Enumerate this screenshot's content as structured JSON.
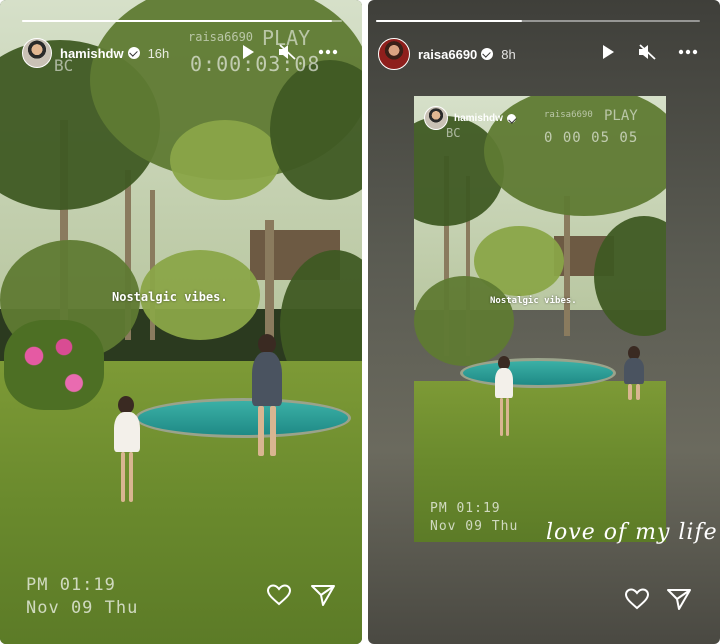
{
  "left_story": {
    "username": "hamishdw",
    "time_ago": "16h",
    "vhs_top_left": "raisa6690",
    "vhs_play": "PLAY",
    "vhs_bc": "BC",
    "vhs_timecode": "0:00:03:08",
    "caption": "Nostalgic vibes.",
    "date_line1": "PM 01:19",
    "date_line2": "Nov 09 Thu",
    "progress": 0.97,
    "icons": [
      "play-icon",
      "mute-icon",
      "more-icon",
      "heart-icon",
      "send-icon"
    ]
  },
  "right_story": {
    "username": "raisa6690",
    "time_ago": "8h",
    "progress": 0.5,
    "shared_post": {
      "username": "hamishdw",
      "vhs_top_left": "raisa6690",
      "vhs_play": "PLAY",
      "vhs_bc": "BC",
      "vhs_timecode": "0 00 05 05",
      "caption": "Nostalgic vibes.",
      "date_line1": "PM 01:19",
      "date_line2": "Nov 09 Thu"
    },
    "handwritten_text": "love of my life",
    "icons": [
      "play-icon",
      "mute-icon",
      "more-icon",
      "heart-icon",
      "send-icon"
    ]
  },
  "colors": {
    "progress_fill": "#ffffff",
    "grass": "#6a8a2d",
    "pool": "#2a9d96",
    "right_bg": "#5a5b52"
  }
}
